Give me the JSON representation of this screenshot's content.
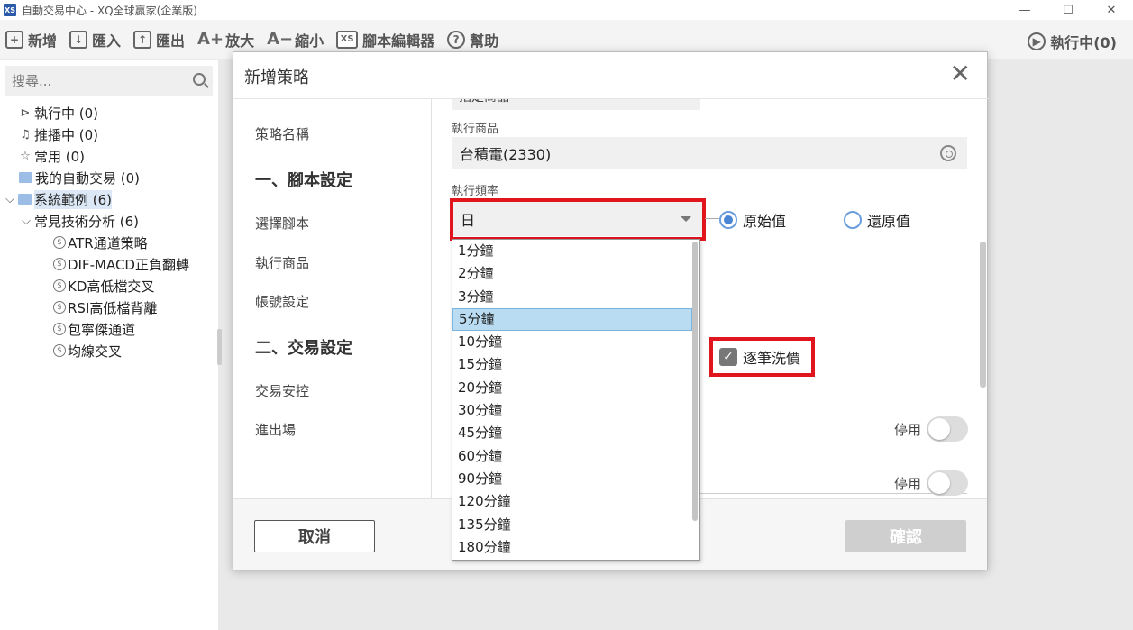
{
  "window": {
    "title": "自動交易中心 - XQ全球贏家(企業版)",
    "app_icon": "XS",
    "minimize": "—",
    "maximize": "☐",
    "close": "✕"
  },
  "toolbar": {
    "new": "新增",
    "import": "匯入",
    "export": "匯出",
    "zoom_in": "放大",
    "zoom_out": "縮小",
    "script_editor": "腳本編輯器",
    "help": "幫助",
    "running": "執行中(0)"
  },
  "sidebar": {
    "search_placeholder": "搜尋...",
    "items": [
      {
        "label": "執行中 (0)"
      },
      {
        "label": "推播中 (0)"
      },
      {
        "label": "常用 (0)"
      },
      {
        "label": "我的自動交易 (0)"
      },
      {
        "label": "系統範例 (6)"
      },
      {
        "label": "常見技術分析 (6)"
      }
    ],
    "strategies": [
      {
        "label": "ATR通道策略"
      },
      {
        "label": "DIF-MACD正負翻轉"
      },
      {
        "label": "KD高低檔交叉"
      },
      {
        "label": "RSI高低檔背離"
      },
      {
        "label": "包寧傑通道"
      },
      {
        "label": "均線交叉"
      }
    ]
  },
  "dialog": {
    "title": "新增策略",
    "nav": {
      "strategy_name": "策略名稱",
      "section1": "一、腳本設定",
      "select_script": "選擇腳本",
      "exec_symbol": "執行商品",
      "account_settings": "帳號設定",
      "section2": "二、交易設定",
      "trade_control": "交易安控",
      "entry_exit": "進出場"
    },
    "partial_field_text": "指定商品",
    "exec_symbol_label": "執行商品",
    "exec_symbol_value": "台積電(2330)",
    "freq_label": "執行頻率",
    "freq_value": "日",
    "radio_original": "原始值",
    "radio_restored": "還原值",
    "tick_wash": "逐筆洗價",
    "disabled_1": "停用",
    "disabled_2": "停用",
    "cancel": "取消",
    "confirm": "確認"
  },
  "dropdown": {
    "options": [
      "1分鐘",
      "2分鐘",
      "3分鐘",
      "5分鐘",
      "10分鐘",
      "15分鐘",
      "20分鐘",
      "30分鐘",
      "45分鐘",
      "60分鐘",
      "90分鐘",
      "120分鐘",
      "135分鐘",
      "180分鐘"
    ],
    "highlighted": "5分鐘"
  },
  "colors": {
    "highlight_red": "#e0151d",
    "radio_blue": "#4a86d4",
    "selected_item_bg": "#b9dcf2"
  }
}
